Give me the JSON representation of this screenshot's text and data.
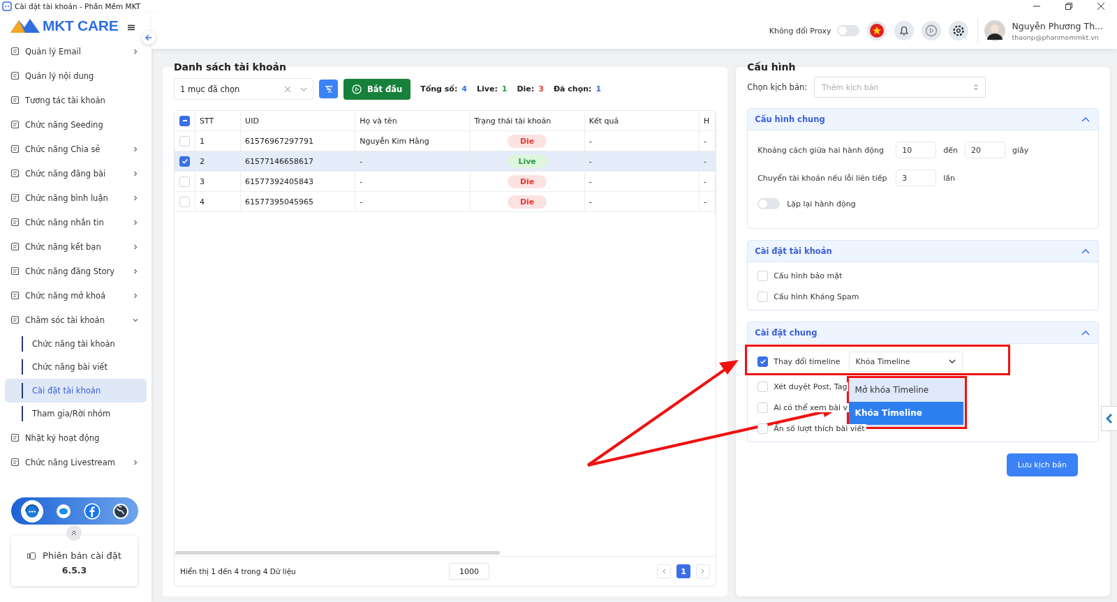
{
  "window": {
    "title": "Cài đặt tài khoản - Phần Mềm MKT"
  },
  "logo": {
    "text": "MKT CARE"
  },
  "sidebar": {
    "items": [
      {
        "label": "Quản lý Email",
        "kind": "group",
        "expanded": false
      },
      {
        "label": "Quản lý nội dung",
        "kind": "link"
      },
      {
        "label": "Tương tác tài khoản",
        "kind": "link"
      },
      {
        "label": "Chức năng Seeding",
        "kind": "link"
      },
      {
        "label": "Chức năng Chia sẻ",
        "kind": "group",
        "expanded": false
      },
      {
        "label": "Chức năng đăng bài",
        "kind": "group",
        "expanded": false
      },
      {
        "label": "Chức năng bình luận",
        "kind": "group",
        "expanded": false
      },
      {
        "label": "Chức năng nhắn tin",
        "kind": "group",
        "expanded": false
      },
      {
        "label": "Chức năng kết bạn",
        "kind": "group",
        "expanded": false
      },
      {
        "label": "Chức năng đăng Story",
        "kind": "group",
        "expanded": false
      },
      {
        "label": "Chức năng mở khoá",
        "kind": "group",
        "expanded": false
      },
      {
        "label": "Chăm sóc tài khoản",
        "kind": "group",
        "expanded": true,
        "children": [
          {
            "label": "Chức năng tài khoản",
            "selected": false
          },
          {
            "label": "Chức năng bài viết",
            "selected": false
          },
          {
            "label": "Cài đặt tài khoản",
            "selected": true
          },
          {
            "label": "Tham gia/Rời nhóm",
            "selected": false
          }
        ]
      },
      {
        "label": "Nhật ký hoạt động",
        "kind": "link"
      },
      {
        "label": "Chức năng Livestream",
        "kind": "group",
        "expanded": false
      }
    ],
    "version": {
      "label": "Phiên bản cài đặt",
      "number": "6.5.3"
    }
  },
  "header": {
    "proxy_label": "Không đổi Proxy",
    "proxy_on": false,
    "user_name": "Nguyễn Phương Th...",
    "user_email": "thaonp@phanmemmkt.vn"
  },
  "accounts": {
    "title": "Danh sách tài khoản",
    "filter_select": {
      "value": "1 mục đã chọn"
    },
    "start_button": "Bắt đầu",
    "stats": [
      {
        "label": "Tổng số:",
        "value": "4",
        "color": "#3b6fe8"
      },
      {
        "label": "Live:",
        "value": "1",
        "color": "#2e9b4a"
      },
      {
        "label": "Die:",
        "value": "3",
        "color": "#e53935"
      },
      {
        "label": "Đã chọn:",
        "value": "1",
        "color": "#3b6fe8"
      }
    ],
    "select_all": {
      "checked": true,
      "indeterminate": true
    },
    "table": {
      "columns": [
        "STT",
        "UID",
        "Họ và tên",
        "Trạng thái tài khoản",
        "Kết quả",
        "H"
      ],
      "rows": [
        {
          "selected": false,
          "cells": [
            "1",
            "61576967297791",
            "Nguyễn Kim Hằng",
            "Die",
            "-",
            "-"
          ],
          "live": false
        },
        {
          "selected": true,
          "cells": [
            "2",
            "61577146658617",
            "-",
            "Live",
            "-",
            "-"
          ],
          "live": true
        },
        {
          "selected": false,
          "cells": [
            "3",
            "61577392405843",
            "-",
            "Die",
            "-",
            "-"
          ],
          "live": false
        },
        {
          "selected": false,
          "cells": [
            "4",
            "61577395045965",
            "-",
            "Die",
            "-",
            "-"
          ],
          "live": false
        }
      ]
    },
    "footer": {
      "summary": "Hiển thị 1 đến 4 trong 4 Dữ liệu",
      "page_size": "1000",
      "pages": [
        {
          "label": "1",
          "selected": true
        }
      ]
    }
  },
  "config": {
    "title": "Cấu hình",
    "script_label": "Chọn kịch bản:",
    "script_select": {
      "placeholder": "Thêm kịch bản"
    },
    "sections": [
      {
        "title": "Cấu hình chung",
        "expanded": true,
        "rows": [
          {
            "kind": "range",
            "label": "Khoảng cách giữa hai hành động",
            "from": "10",
            "joiner": "đến",
            "to": "20",
            "unit": "giây"
          },
          {
            "kind": "number",
            "label": "Chuyển tài khoản nếu lỗi liên tiếp",
            "value": "3",
            "unit": "lần"
          },
          {
            "kind": "toggle",
            "label": "Lặp lại hành động",
            "on": false
          }
        ]
      },
      {
        "title": "Cài đặt tài khoản",
        "expanded": true,
        "rows": [
          {
            "kind": "checkbox",
            "label": "Cấu hình bảo mật",
            "checked": false
          },
          {
            "kind": "checkbox",
            "label": "Cấu hình Kháng Spam",
            "checked": false
          }
        ]
      },
      {
        "title": "Cài đặt chung",
        "expanded": true,
        "rows": [
          {
            "kind": "checkbox-select",
            "label": "Thay đổi timeline",
            "checked": true,
            "value": "Khóa Timeline",
            "open": true,
            "options": [
              {
                "label": "Mở khóa Timeline",
                "selected": false
              },
              {
                "label": "Khóa Timeline",
                "selected": true
              }
            ]
          },
          {
            "kind": "checkbox",
            "label": "Xét duyệt Post, Tag",
            "checked": false
          },
          {
            "kind": "checkbox",
            "label": "Ai có thể xem bài v",
            "checked": false
          },
          {
            "kind": "checkbox",
            "label": "Ẩn số lượt thích bài viết",
            "checked": false
          }
        ]
      }
    ],
    "save_button": "Lưu kịch bản"
  }
}
